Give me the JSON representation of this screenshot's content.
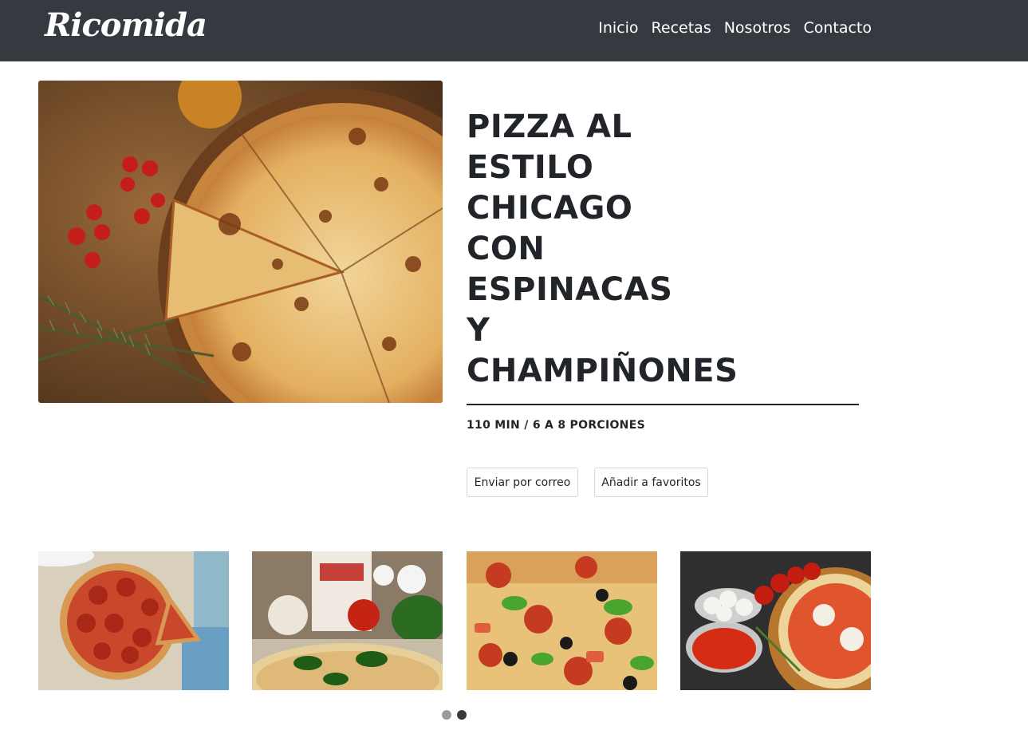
{
  "navbar": {
    "brand": "Ricomida",
    "links": [
      "Inicio",
      "Recetas",
      "Nosotros",
      "Contacto"
    ]
  },
  "recipe": {
    "title_lines": [
      "PIZZA AL",
      "ESTILO",
      "CHICAGO",
      "CON",
      "ESPINACAS",
      "Y",
      "CHAMPIÑONES"
    ],
    "meta": "110 MIN / 6 A 8 PORCIONES",
    "buttons": {
      "email": "Enviar por correo",
      "favorite": "Añadir a favoritos"
    }
  },
  "carousel": {
    "pages": 2,
    "active_page": 2
  },
  "colors": {
    "navbar": "#343a40",
    "text": "#212529",
    "border": "#d6d8db"
  }
}
